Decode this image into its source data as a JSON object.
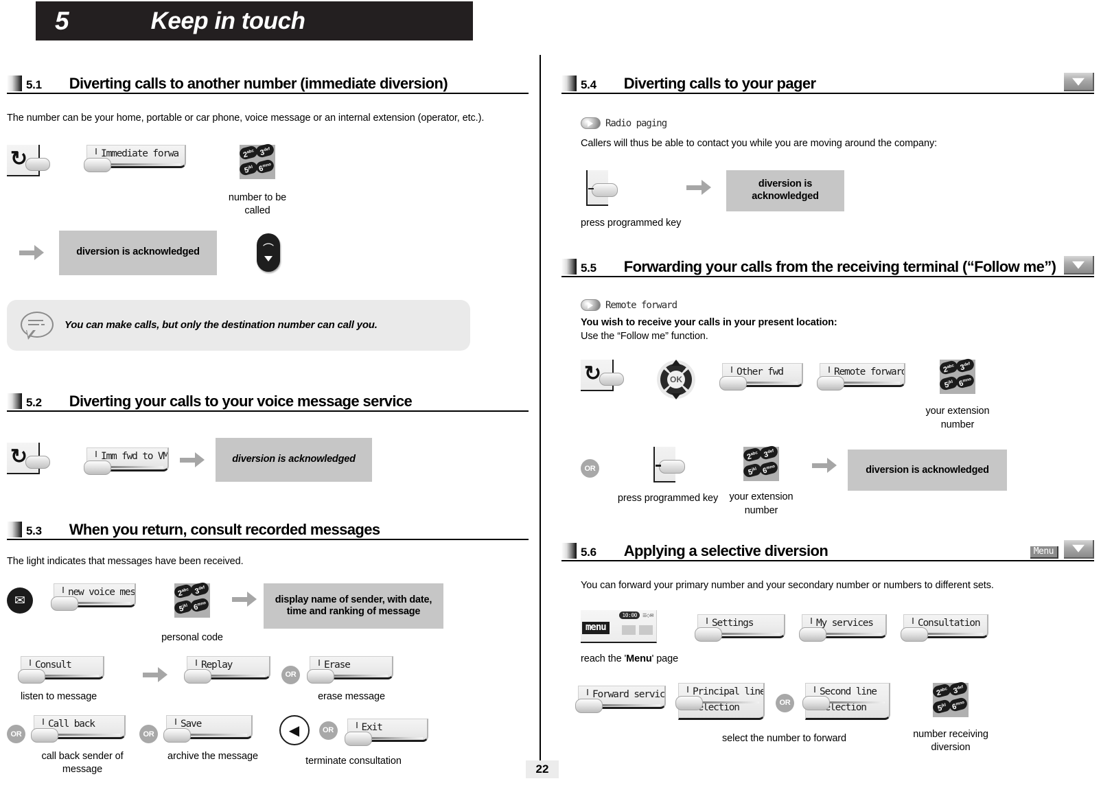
{
  "chapter": {
    "number": "5",
    "title": "Keep in touch"
  },
  "page_number": "22",
  "sections": {
    "s51": {
      "num": "5.1",
      "title": "Diverting calls to another number (immediate diversion)",
      "intro": "The number can be your home, portable or car phone, voice message or an internal extension (operator, etc.).",
      "softkey_1": "Immediate forwa",
      "keypad_caption": "number to be called",
      "result": "diversion is acknowledged",
      "note": "You can make calls, but only the destination number can call you."
    },
    "s52": {
      "num": "5.2",
      "title": "Diverting your calls to your voice message service",
      "softkey_1": "Imm fwd to VM",
      "result": "diversion is acknowledged"
    },
    "s53": {
      "num": "5.3",
      "title": "When you return, consult recorded messages",
      "intro": "The light indicates that messages have been received.",
      "softkey_1": "new voice mess",
      "keypad_caption": "personal code",
      "result": "display name of sender, with date, time and ranking of message",
      "softkey_consult": "Consult",
      "softkey_replay": "Replay",
      "softkey_erase": "Erase",
      "cap_listen": "listen to message",
      "cap_erase": "erase message",
      "softkey_callback": "Call back",
      "softkey_save": "Save",
      "softkey_exit": "Exit",
      "cap_callback": "call back sender of message",
      "cap_archive": "archive the message",
      "cap_terminate": "terminate consultation",
      "or": "OR"
    },
    "s54": {
      "num": "5.4",
      "title": "Diverting calls to your pager",
      "feature": "Radio paging",
      "intro": "Callers will thus be able to contact you while you are moving around the company:",
      "cap_progkey": "press programmed key",
      "result": "diversion is acknowledged"
    },
    "s55": {
      "num": "5.5",
      "title": "Forwarding your calls from the receiving terminal (“Follow me”)",
      "feature": "Remote forward",
      "intro_bold": "You wish to receive your calls in your present location:",
      "intro_plain": "Use the “Follow me” function.",
      "softkey_other": "Other fwd",
      "softkey_remote": "Remote forward",
      "cap_extension": "your extension number",
      "or": "OR",
      "cap_progkey": "press programmed key",
      "cap_extension2": "your extension number",
      "result": "diversion is acknowledged"
    },
    "s56": {
      "num": "5.6",
      "title": "Applying a selective diversion",
      "badge_menu": "Menu",
      "intro": "You can forward your primary number and your secondary number or numbers to different sets.",
      "screen_clock": "10:00",
      "screen_icons": "☰◇✉",
      "screen_menu": "menu",
      "cap_reach": "reach the 'Menu' page",
      "cap_reach_1": "reach the '",
      "cap_reach_bold": "Menu",
      "cap_reach_2": "' page",
      "softkey_settings": "Settings",
      "softkey_myservices": "My services",
      "softkey_consultation": "Consultation",
      "softkey_forward": "Forward service",
      "softkey_principal_l1": "Principal line",
      "softkey_principal_l2": "selection",
      "softkey_second_l1": "Second line",
      "softkey_second_l2": "selection",
      "or": "OR",
      "cap_select": "select the number to forward",
      "cap_receiving": "number receiving diversion"
    }
  },
  "keypad": {
    "k1": "2",
    "k1s": "abc",
    "k2": "3",
    "k2s": "def",
    "k3": "5",
    "k3s": "jkl",
    "k4": "6",
    "k4s": "mno"
  },
  "icons": {
    "navigator_ok": "OK",
    "envelope": "✉",
    "rewind": "◀",
    "redial": "↺",
    "handset": "⌒"
  }
}
